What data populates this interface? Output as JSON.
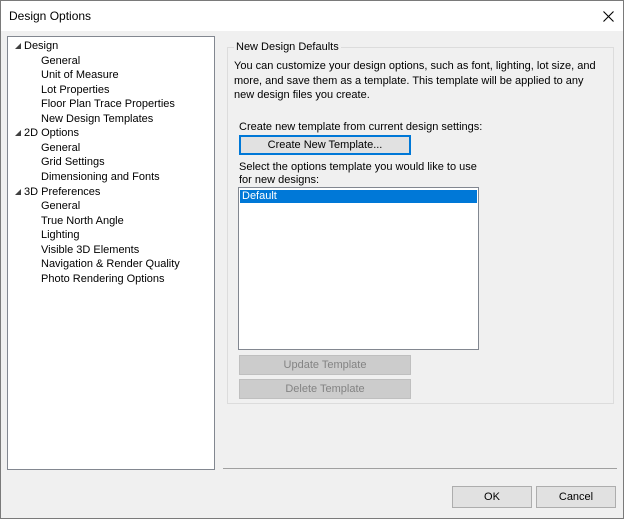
{
  "window": {
    "title": "Design Options"
  },
  "tree": {
    "groups": [
      {
        "label": "Design",
        "children": [
          "General",
          "Unit of Measure",
          "Lot Properties",
          "Floor Plan Trace Properties",
          "New Design Templates"
        ]
      },
      {
        "label": "2D Options",
        "children": [
          "General",
          "Grid Settings",
          "Dimensioning and Fonts"
        ]
      },
      {
        "label": "3D Preferences",
        "children": [
          "General",
          "True North Angle",
          "Lighting",
          "Visible 3D Elements",
          "Navigation & Render Quality",
          "Photo Rendering Options"
        ]
      }
    ]
  },
  "panel": {
    "group_title": "New Design Defaults",
    "description": "You can customize your design options, such as font, lighting, lot size, and more, and save them as a template. This template will be applied to any new design files you create.",
    "create_label": "Create new template from current design settings:",
    "create_button": "Create New Template...",
    "select_label": "Select the options template you would like to use for new designs:",
    "templates": [
      "Default"
    ],
    "update_button": "Update Template",
    "delete_button": "Delete Template"
  },
  "footer": {
    "ok": "OK",
    "cancel": "Cancel"
  }
}
